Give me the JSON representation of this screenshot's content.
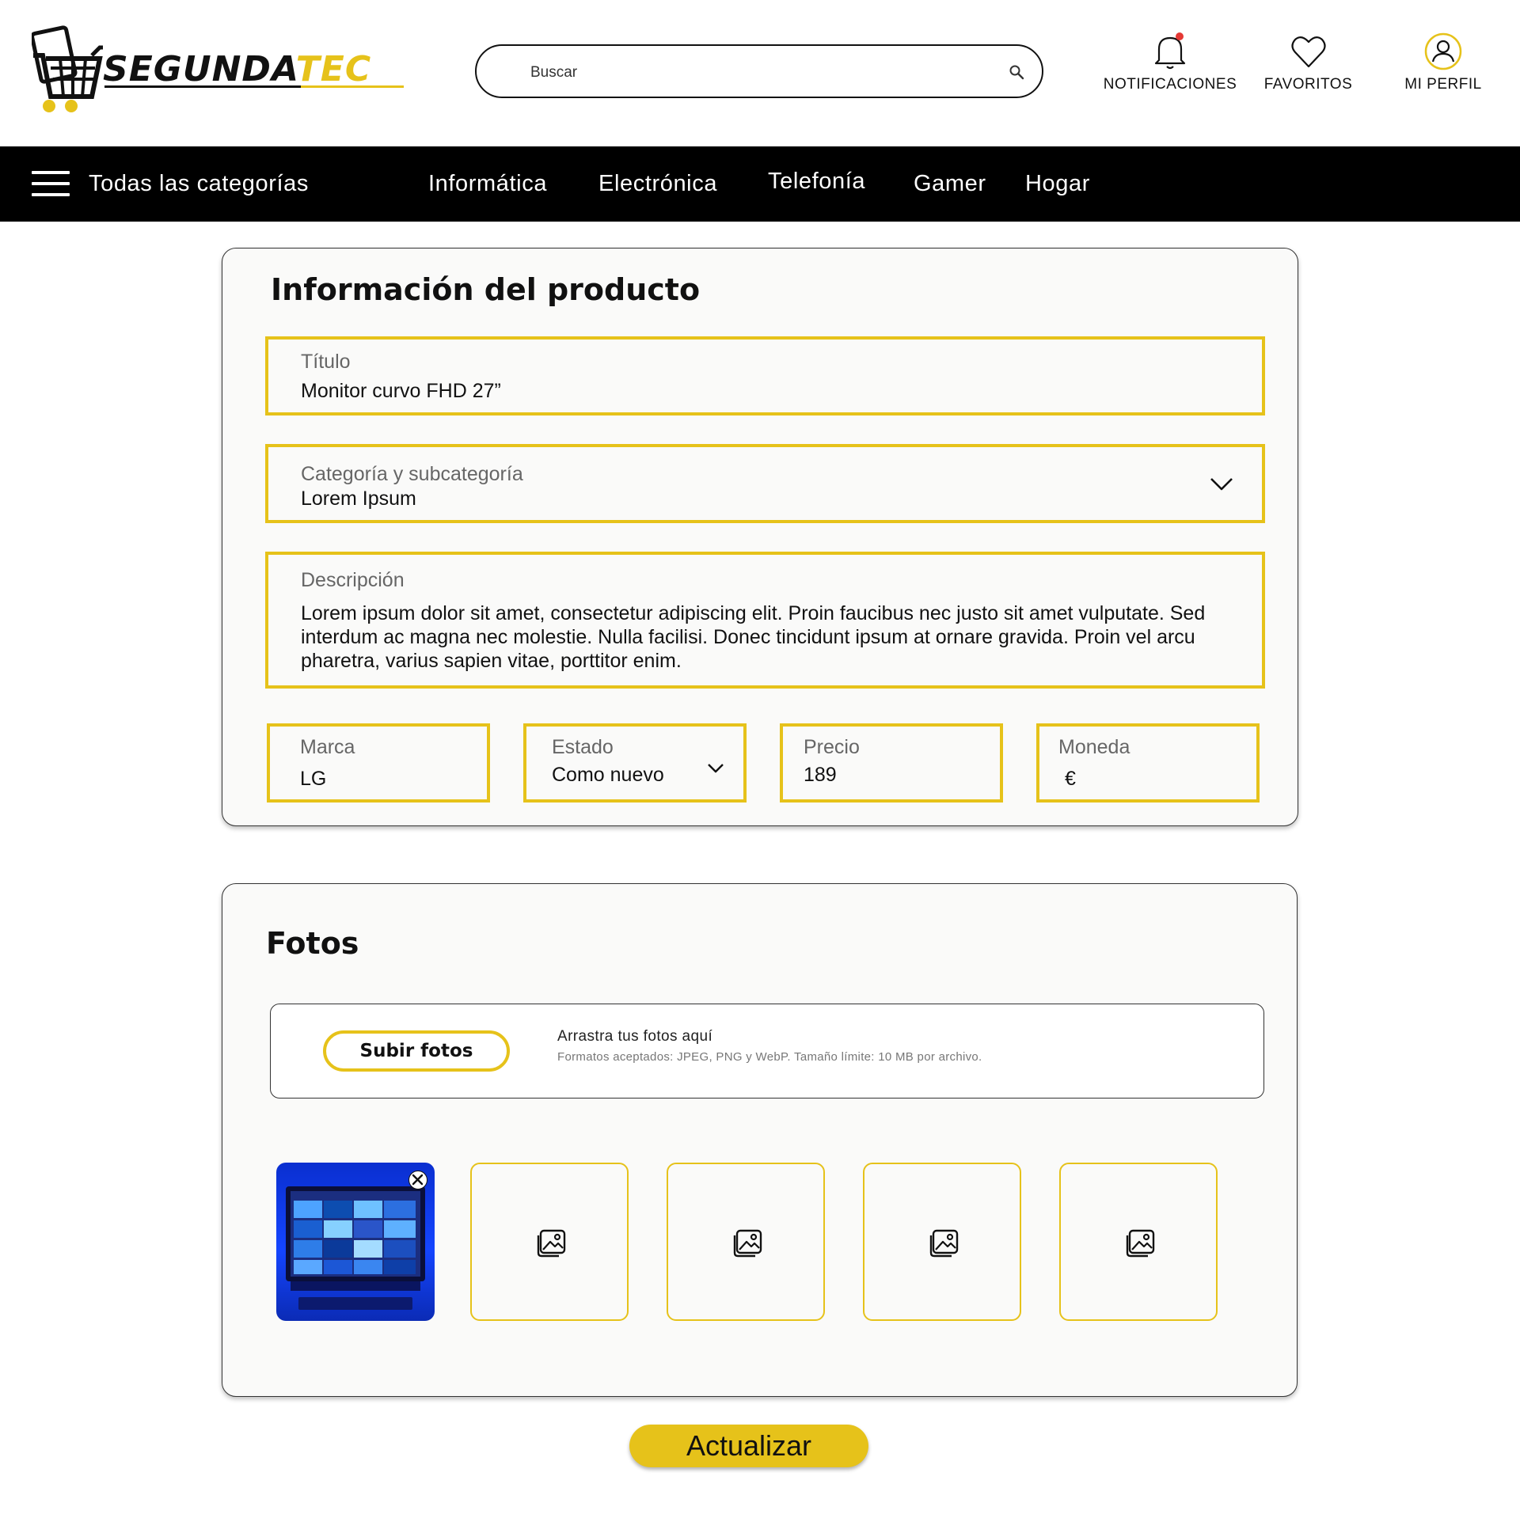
{
  "header": {
    "logo": {
      "brand_main": "SEGUNDA",
      "brand_accent": "TEC"
    },
    "search": {
      "placeholder": "Buscar"
    },
    "actions": {
      "notifications": "NOTIFICACIONES",
      "favorites": "FAVORITOS",
      "profile": "MI PERFIL"
    }
  },
  "nav": {
    "all_categories": "Todas las categorías",
    "items": [
      "Informática",
      "Electrónica",
      "Telefonía",
      "Gamer",
      "Hogar"
    ]
  },
  "product_info": {
    "title": "Información del producto",
    "fields": {
      "titulo": {
        "label": "Título",
        "value": "Monitor curvo FHD 27”"
      },
      "categoria": {
        "label": "Categoría y subcategoría",
        "value": "Lorem Ipsum"
      },
      "descripcion": {
        "label": "Descripción",
        "value": "Lorem ipsum dolor sit amet, consectetur adipiscing elit. Proin faucibus nec justo sit amet vulputate. Sed interdum ac magna nec molestie. Nulla facilisi. Donec tincidunt ipsum at ornare gravida. Proin vel arcu pharetra, varius sapien vitae, porttitor enim."
      },
      "marca": {
        "label": "Marca",
        "value": "LG"
      },
      "estado": {
        "label": "Estado",
        "value": "Como nuevo"
      },
      "precio": {
        "label": "Precio",
        "value": "189"
      },
      "moneda": {
        "label": "Moneda",
        "value": "€"
      }
    }
  },
  "photos": {
    "title": "Fotos",
    "upload_button": "Subir fotos",
    "drop_title": "Arrastra tus fotos aquí",
    "drop_hint": "Formatos aceptados: JPEG, PNG y WebP. Tamaño límite: 10 MB por archivo."
  },
  "actions": {
    "update": "Actualizar"
  },
  "colors": {
    "accent": "#e6c21a",
    "nav_bg": "#000000",
    "notification_dot": "#e53935"
  },
  "icons": [
    "cart-logo-icon",
    "search-icon",
    "bell-icon",
    "heart-icon",
    "user-icon",
    "menu-icon",
    "chevron-down-icon",
    "image-placeholder-icon",
    "close-icon"
  ]
}
